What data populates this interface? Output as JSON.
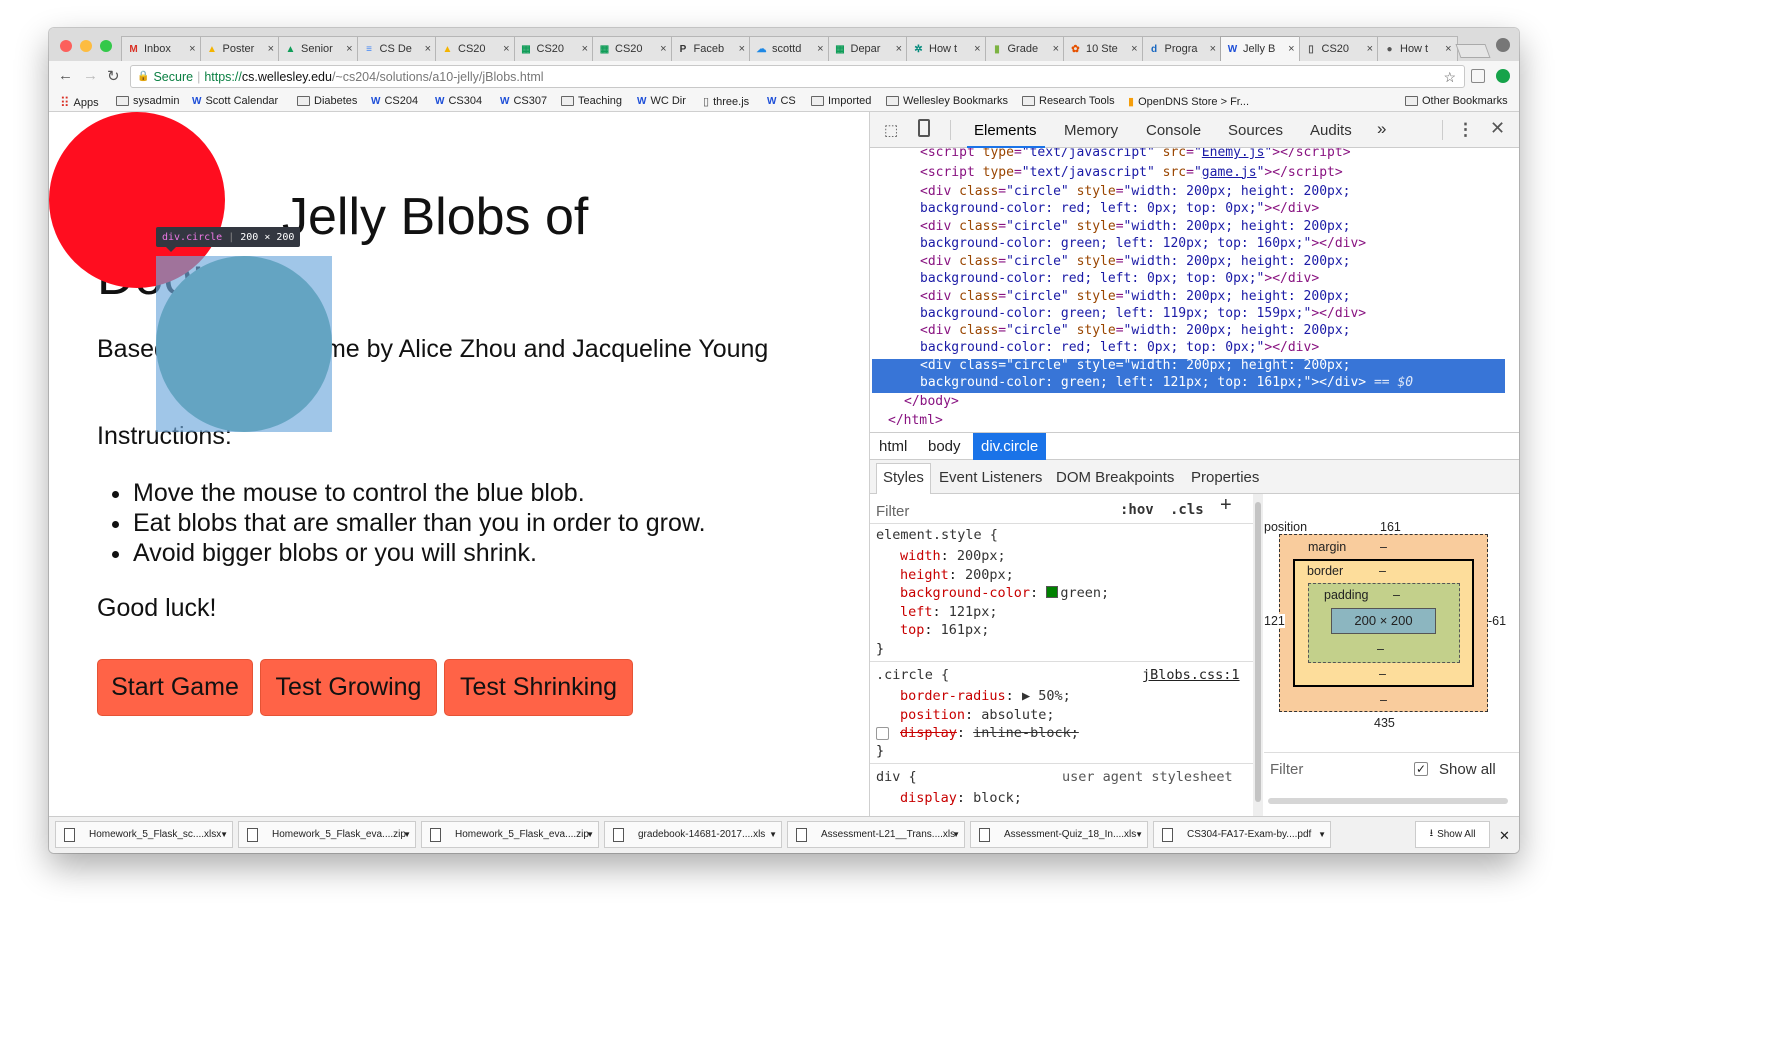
{
  "tabs": [
    {
      "title": "Inbox",
      "icon": "gmail-icon",
      "glyph": "M",
      "color": "#d93025"
    },
    {
      "title": "Poster",
      "icon": "drive-icon",
      "glyph": "▲",
      "color": "#f4b400"
    },
    {
      "title": "Senior",
      "icon": "drive-icon",
      "glyph": "▲",
      "color": "#0f9d58"
    },
    {
      "title": "CS De",
      "icon": "docs-icon",
      "glyph": "≡",
      "color": "#4285f4"
    },
    {
      "title": "CS20",
      "icon": "drive-icon",
      "glyph": "▲",
      "color": "#f4b400"
    },
    {
      "title": "CS20",
      "icon": "sheets-icon",
      "glyph": "▦",
      "color": "#0f9d58"
    },
    {
      "title": "CS20",
      "icon": "sheets-icon",
      "glyph": "▦",
      "color": "#0f9d58"
    },
    {
      "title": "Faceb",
      "icon": "piazza-icon",
      "glyph": "P",
      "color": "#333333"
    },
    {
      "title": "scottd",
      "icon": "cloud-icon",
      "glyph": "☁",
      "color": "#1e88e5"
    },
    {
      "title": "Depar",
      "icon": "sheets-icon",
      "glyph": "▦",
      "color": "#0f9d58"
    },
    {
      "title": "How t",
      "icon": "globe-icon",
      "glyph": "✲",
      "color": "#00897b"
    },
    {
      "title": "Grade",
      "icon": "bar-chart-icon",
      "glyph": "▮",
      "color": "#7cb342"
    },
    {
      "title": "10 Ste",
      "icon": "gear-icon",
      "glyph": "✿",
      "color": "#e65100"
    },
    {
      "title": "Progra",
      "icon": "d-icon",
      "glyph": "d",
      "color": "#1565c0"
    },
    {
      "title": "Jelly B",
      "icon": "wellesley-icon",
      "glyph": "W",
      "color": "#1d4ed8"
    },
    {
      "title": "CS20",
      "icon": "page-icon",
      "glyph": "▯",
      "color": "#555555"
    },
    {
      "title": "How t",
      "icon": "apple-icon",
      "glyph": "●",
      "color": "#555555"
    }
  ],
  "active_tab": 14,
  "omnibox": {
    "secure_label": "Secure",
    "scheme": "https://",
    "host": "cs.wellesley.edu",
    "path": "/~cs204/solutions/a10-jelly/jBlobs.html"
  },
  "bookmarks": [
    {
      "label": "Apps",
      "icon": "apps-grid-icon"
    },
    {
      "label": "sysadmin",
      "icon": "folder-icon"
    },
    {
      "label": "Scott Calendar",
      "icon": "wellesley-icon"
    },
    {
      "label": "Diabetes",
      "icon": "folder-icon"
    },
    {
      "label": "CS204",
      "icon": "wellesley-icon"
    },
    {
      "label": "CS304",
      "icon": "wellesley-icon"
    },
    {
      "label": "CS307",
      "icon": "wellesley-icon"
    },
    {
      "label": "Teaching",
      "icon": "folder-icon"
    },
    {
      "label": "WC Dir",
      "icon": "wellesley-icon"
    },
    {
      "label": "three.js",
      "icon": "page-icon"
    },
    {
      "label": "CS",
      "icon": "wellesley-icon"
    },
    {
      "label": "Imported",
      "icon": "folder-icon"
    },
    {
      "label": "Wellesley Bookmarks",
      "icon": "folder-icon"
    },
    {
      "label": "Research Tools",
      "icon": "folder-icon"
    },
    {
      "label": "OpenDNS Store > Fr...",
      "icon": "opendns-icon"
    }
  ],
  "other_bookmarks": "Other Bookmarks",
  "page": {
    "title": "Jelly Blobs of Doom",
    "credit": "Based on original game by Alice Zhou and Jacqueline Young",
    "instructions_label": "Instructions:",
    "instructions": [
      "Move the mouse to control the blue blob.",
      "Eat blobs that are smaller than you in order to grow.",
      "Avoid bigger blobs or you will shrink."
    ],
    "good_luck": "Good luck!",
    "buttons": [
      "Start Game",
      "Test Growing",
      "Test Shrinking"
    ],
    "circles": [
      {
        "color": "#ff0d1f"
      },
      {
        "color": "#4f9d91"
      }
    ],
    "tooltip": {
      "name": "div.circle",
      "size": "200 × 200"
    }
  },
  "devtools": {
    "tabs": [
      "Elements",
      "Memory",
      "Console",
      "Sources",
      "Audits"
    ],
    "more": "»",
    "code_lines": [
      {
        "kind": "script",
        "src": "Enemy.js"
      },
      {
        "kind": "script",
        "src": "game.js"
      },
      {
        "kind": "div",
        "style1": "width: 200px; height: 200px;",
        "style2": "background-color: red; left: 0px; top: 0px;"
      },
      {
        "kind": "div",
        "style1": "width: 200px; height: 200px;",
        "style2": "background-color: green; left: 120px; top: 160px;"
      },
      {
        "kind": "div",
        "style1": "width: 200px; height: 200px;",
        "style2": "background-color: red; left: 0px; top: 0px;"
      },
      {
        "kind": "div",
        "style1": "width: 200px; height: 200px;",
        "style2": "background-color: green; left: 119px; top: 159px;"
      },
      {
        "kind": "div",
        "style1": "width: 200px; height: 200px;",
        "style2": "background-color: red; left: 0px; top: 0px;"
      },
      {
        "kind": "div",
        "style1": "width: 200px; height: 200px;",
        "style2": "background-color: green; left: 121px; top: 161px;",
        "selected": true,
        "suffix": " == $0"
      }
    ],
    "close_body": "</body>",
    "close_html": "</html>",
    "breadcrumbs": [
      "html",
      "body",
      "div.circle"
    ],
    "subtabs": [
      "Styles",
      "Event Listeners",
      "DOM Breakpoints",
      "Properties"
    ],
    "filter_placeholder": "Filter",
    "hov": ":hov",
    "cls": ".cls",
    "element_style": {
      "selector": "element.style {",
      "props": [
        {
          "name": "width",
          "value": "200px;"
        },
        {
          "name": "height",
          "value": "200px;"
        },
        {
          "name": "background-color",
          "value": "green;"
        },
        {
          "name": "left",
          "value": "121px;"
        },
        {
          "name": "top",
          "value": "161px;"
        }
      ]
    },
    "circle_rule": {
      "selector": ".circle {",
      "source": "jBlobs.css:1",
      "props": [
        {
          "name": "border-radius",
          "value": "▶ 50%;"
        },
        {
          "name": "position",
          "value": "absolute;"
        },
        {
          "name": "display",
          "value": "inline-block;",
          "disabled": true
        }
      ]
    },
    "div_rule": {
      "selector": "div {",
      "source": "user agent stylesheet",
      "props": [
        {
          "name": "display",
          "value": "block;"
        }
      ]
    },
    "box_model": {
      "position_label": "position",
      "top": "161",
      "left": "121",
      "right": "-61",
      "bottom": "435",
      "margin_label": "margin",
      "border_label": "border",
      "padding_label": "padding",
      "content": "200 × 200",
      "dash": "–"
    },
    "computed_filter": "Filter",
    "show_all": "Show all"
  },
  "downloads": [
    "Homework_5_Flask_sc....xlsx",
    "Homework_5_Flask_eva....zip",
    "Homework_5_Flask_eva....zip",
    "gradebook-14681-2017....xls",
    "Assessment-L21__Trans....xls",
    "Assessment-Quiz_18_In....xls",
    "CS304-FA17-Exam-by....pdf"
  ],
  "show_all_downloads": "Show All"
}
